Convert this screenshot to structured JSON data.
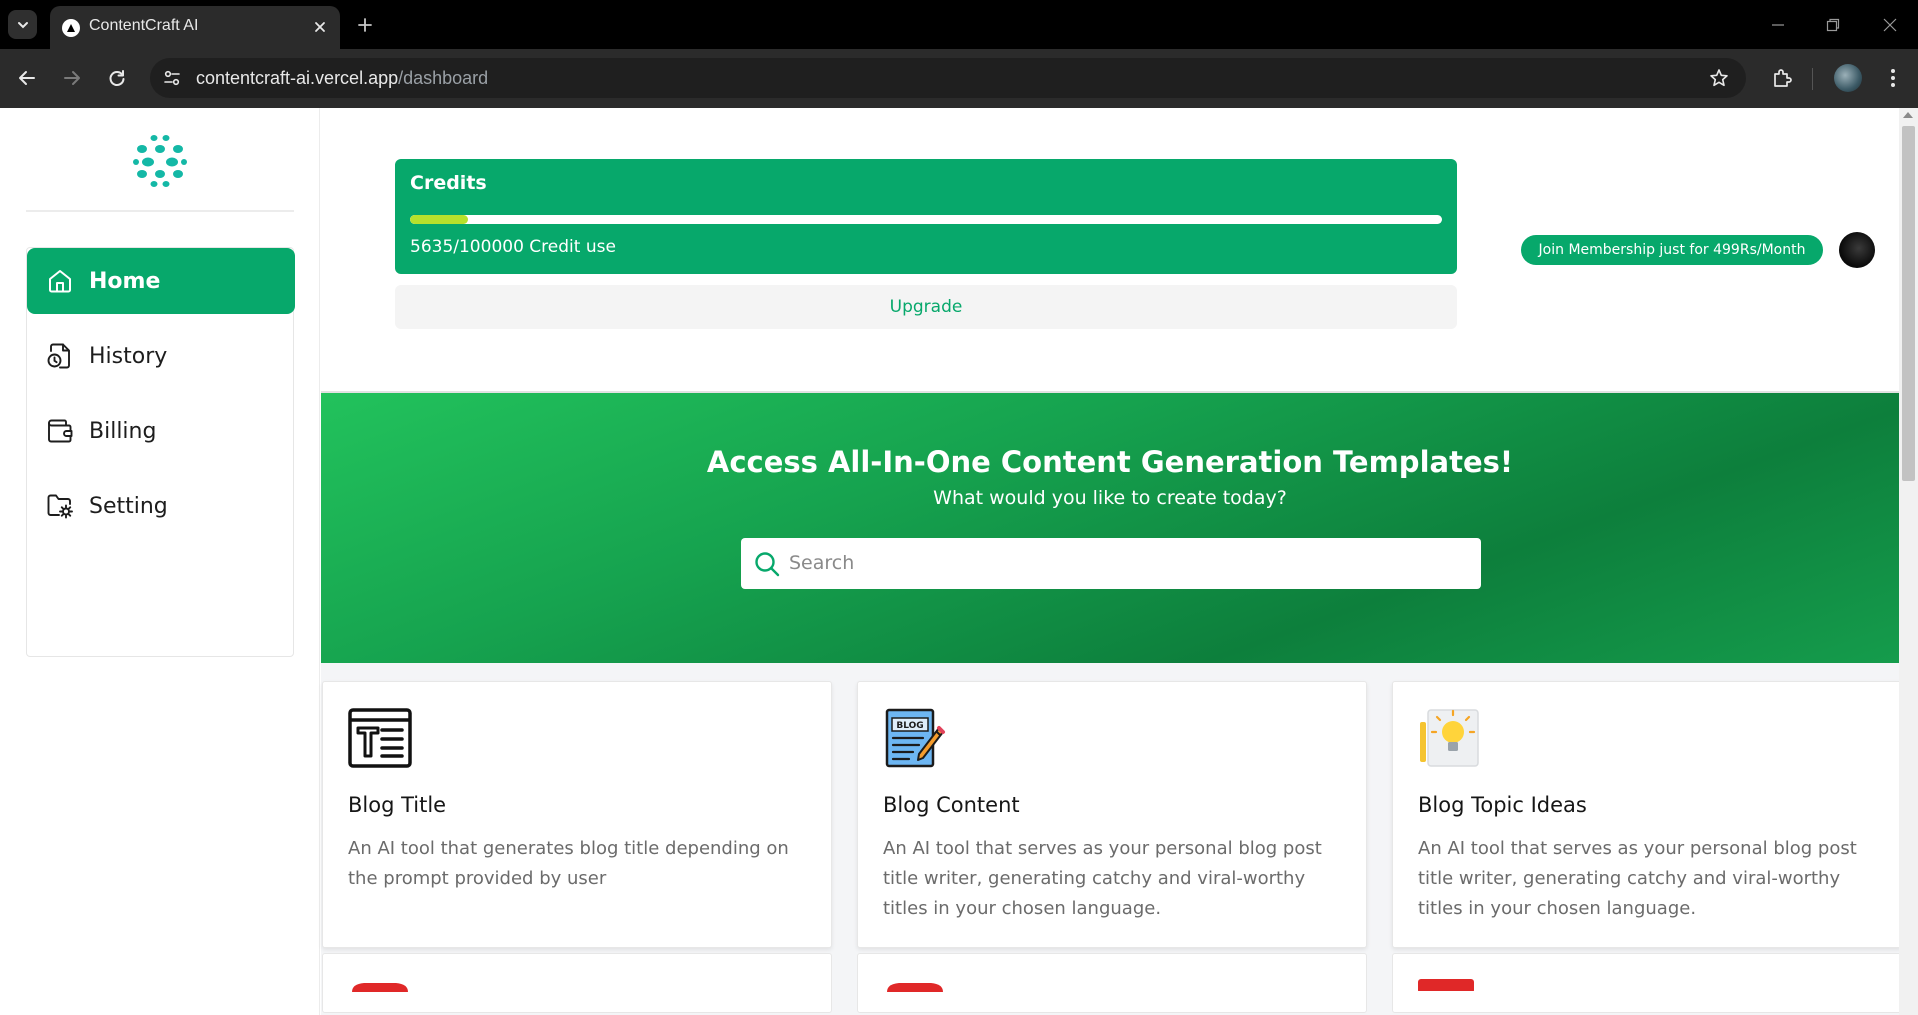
{
  "browser": {
    "tab_title": "ContentCraft AI",
    "url_host": "contentcraft-ai.vercel.app",
    "url_path": "/dashboard"
  },
  "sidebar": {
    "items": [
      {
        "label": "Home",
        "icon": "home-icon",
        "active": true
      },
      {
        "label": "History",
        "icon": "history-icon",
        "active": false
      },
      {
        "label": "Billing",
        "icon": "wallet-icon",
        "active": false
      },
      {
        "label": "Setting",
        "icon": "folder-cog-icon",
        "active": false
      }
    ]
  },
  "credits": {
    "title": "Credits",
    "used": 5635,
    "total": 100000,
    "usage_text": "5635/100000 Credit use",
    "upgrade_label": "Upgrade"
  },
  "header": {
    "membership_label": "Join Membership just for 499Rs/Month"
  },
  "hero": {
    "title": "Access All-In-One Content Generation Templates!",
    "subtitle": "What would you like to create today?",
    "search_placeholder": "Search"
  },
  "templates": [
    {
      "title": "Blog Title",
      "description": "An AI tool that generates blog title depending on the prompt provided by user",
      "icon": "title-icon"
    },
    {
      "title": "Blog Content",
      "description": "An AI tool that serves as your personal blog post title writer, generating catchy and viral-worthy titles in your chosen language.",
      "icon": "blog-icon"
    },
    {
      "title": "Blog Topic Ideas",
      "description": "An AI tool that serves as your personal blog post title writer, generating catchy and viral-worthy titles in your chosen language.",
      "icon": "lightbulb-icon"
    }
  ],
  "colors": {
    "brand": "#07a86b",
    "progress": "#b6e12c",
    "hero_start": "#22c25c",
    "hero_mid": "#0d7f3c"
  }
}
